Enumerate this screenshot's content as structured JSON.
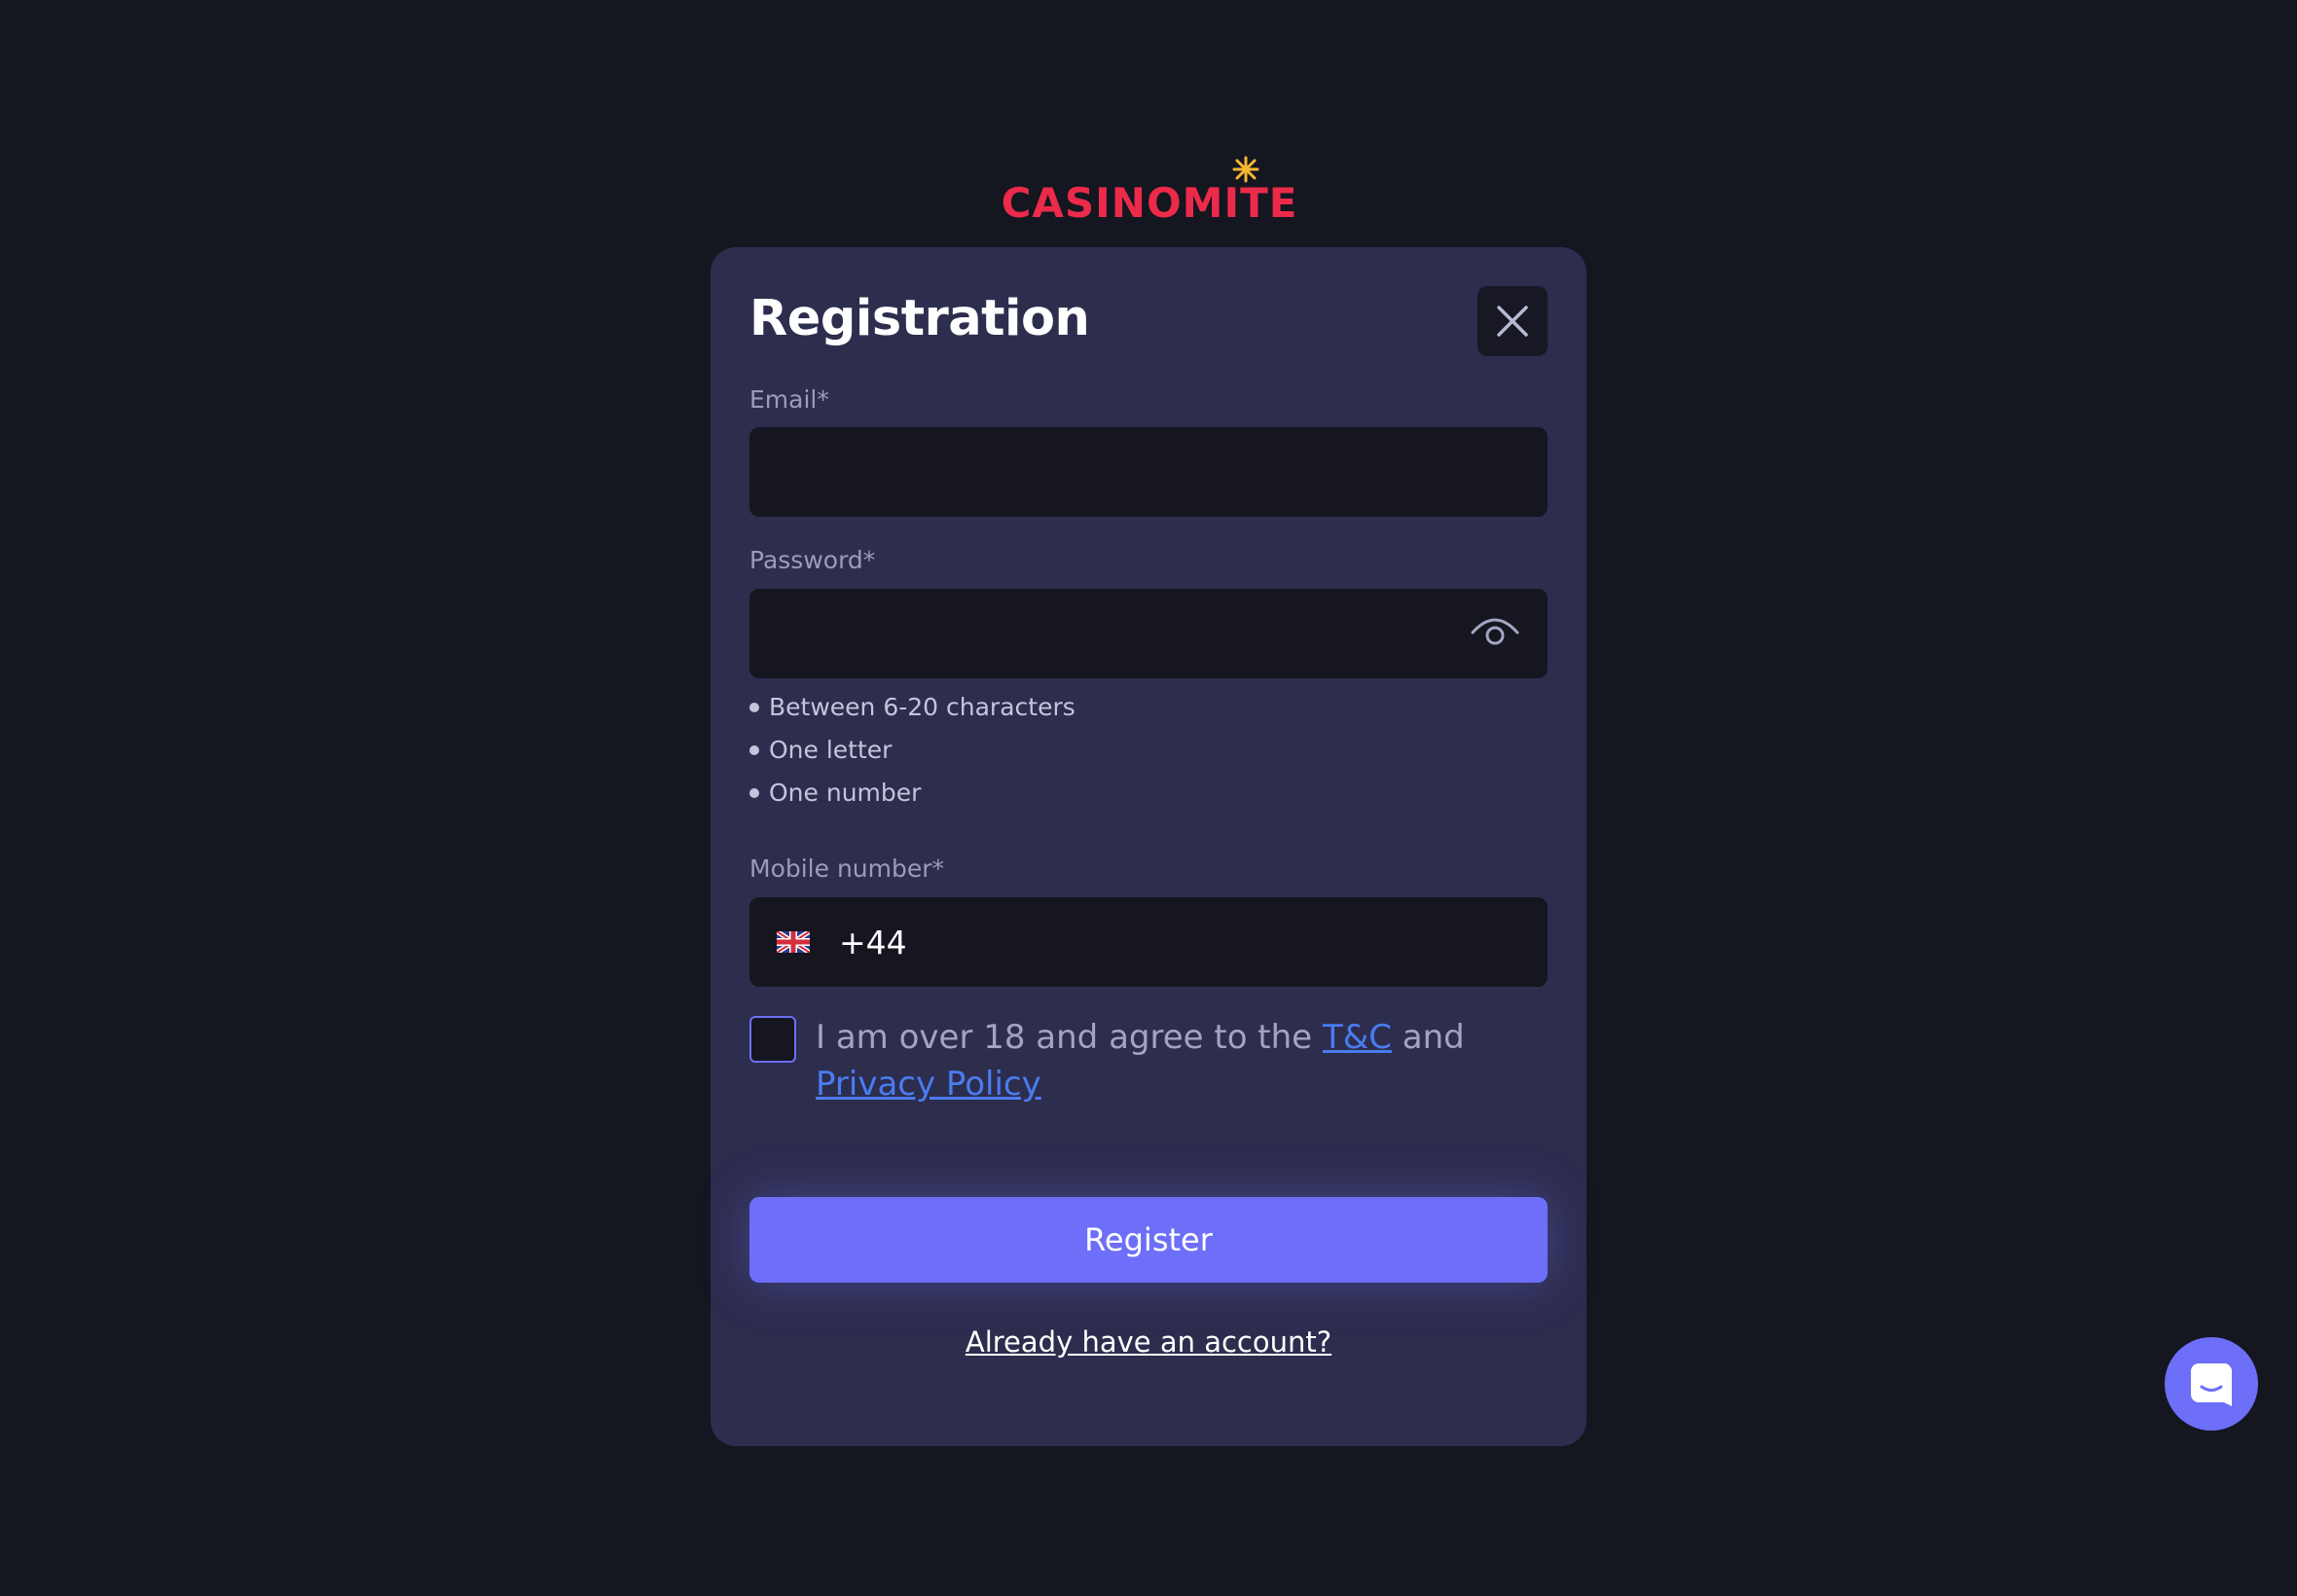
{
  "brand": {
    "logo_text": "CASINOMITE",
    "color": "#ec2a4a"
  },
  "modal": {
    "title": "Registration",
    "email": {
      "label": "Email*",
      "value": ""
    },
    "password": {
      "label": "Password*",
      "value": "",
      "rules": [
        "Between 6-20 characters",
        "One letter",
        "One number"
      ]
    },
    "mobile": {
      "label": "Mobile number*",
      "country_code": "+44",
      "flag": "uk-flag-icon"
    },
    "agreement": {
      "prefix": "I am over 18 and agree to the ",
      "tc_link": "T&C",
      "middle": " and ",
      "privacy_link": "Privacy Policy",
      "checked": false
    },
    "register_label": "Register",
    "login_link": "Already have an account?"
  },
  "colors": {
    "background": "#141620",
    "modal": "#2d2d4e",
    "accent": "#6d6ff8",
    "link": "#4a7cf0"
  }
}
